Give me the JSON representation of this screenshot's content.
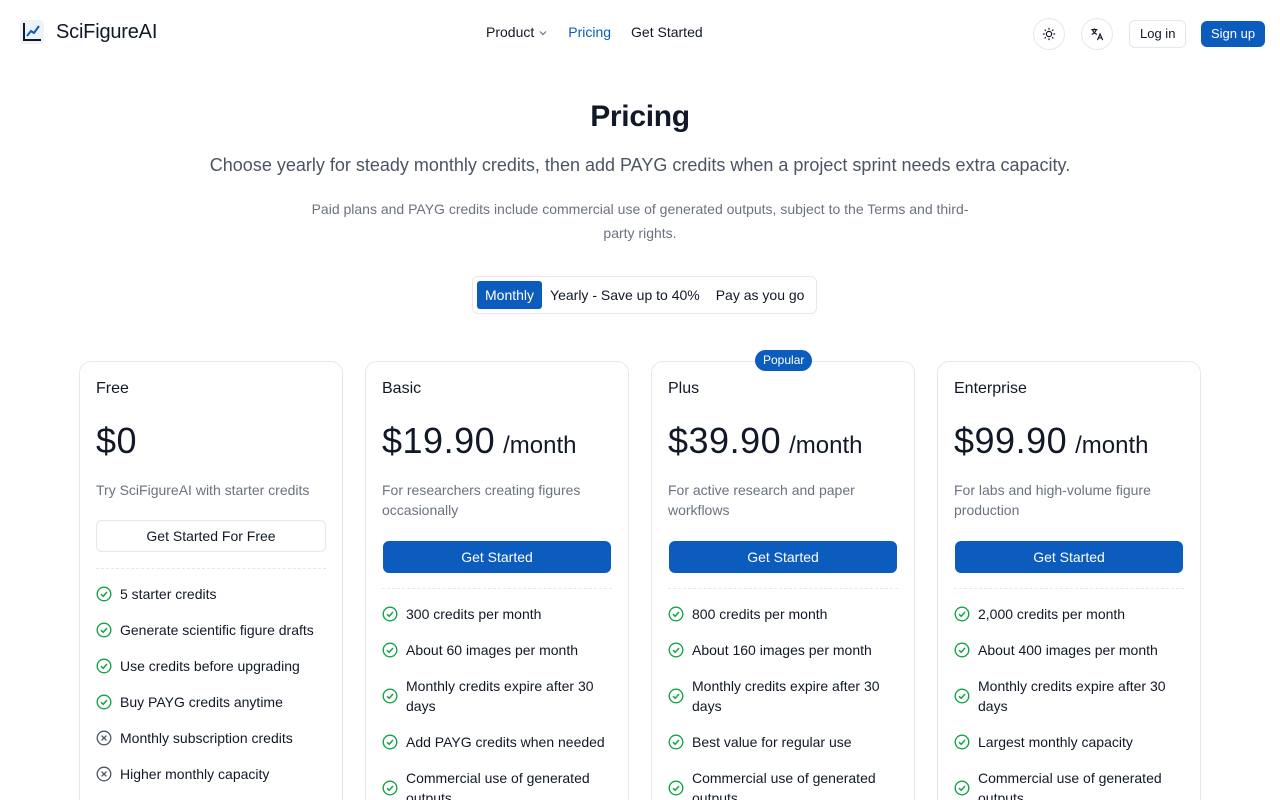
{
  "brand": {
    "name": "SciFigureAI",
    "accent": "#0b5cbd"
  },
  "nav": {
    "product": "Product",
    "pricing": "Pricing",
    "get_started": "Get Started",
    "theme_icon": "sun-icon",
    "language_icon": "translate-icon",
    "login": "Log in",
    "signup": "Sign up"
  },
  "hero": {
    "title": "Pricing",
    "subtitle": "Choose yearly for steady monthly credits, then add PAYG credits when a project sprint needs extra capacity.",
    "note": "Paid plans and PAYG credits include commercial use of generated outputs, subject to the Terms and third-party rights."
  },
  "billing_toggle": {
    "options": [
      "Monthly",
      "Yearly - Save up to 40%",
      "Pay as you go"
    ],
    "selected": "Monthly"
  },
  "plans": [
    {
      "name": "Free",
      "price": "$0",
      "period": "",
      "description": "Try SciFigureAI with starter credits",
      "cta": "Get Started For Free",
      "features": [
        {
          "text": "5 starter credits",
          "included": true
        },
        {
          "text": "Generate scientific figure drafts",
          "included": true
        },
        {
          "text": "Use credits before upgrading",
          "included": true
        },
        {
          "text": "Buy PAYG credits anytime",
          "included": true
        },
        {
          "text": "Monthly subscription credits",
          "included": false
        },
        {
          "text": "Higher monthly capacity",
          "included": false
        }
      ]
    },
    {
      "name": "Basic",
      "price": "$19.90",
      "period": "/month",
      "description": "For researchers creating figures occasionally",
      "cta": "Get Started",
      "features": [
        {
          "text": "300 credits per month",
          "included": true
        },
        {
          "text": "About 60 images per month",
          "included": true
        },
        {
          "text": "Monthly credits expire after 30 days",
          "included": true
        },
        {
          "text": "Add PAYG credits when needed",
          "included": true
        },
        {
          "text": "Commercial use of generated outputs",
          "included": true
        }
      ]
    },
    {
      "name": "Plus",
      "badge": "Popular",
      "price": "$39.90",
      "period": "/month",
      "description": "For active research and paper workflows",
      "cta": "Get Started",
      "features": [
        {
          "text": "800 credits per month",
          "included": true
        },
        {
          "text": "About 160 images per month",
          "included": true
        },
        {
          "text": "Monthly credits expire after 30 days",
          "included": true
        },
        {
          "text": "Best value for regular use",
          "included": true
        },
        {
          "text": "Commercial use of generated outputs",
          "included": true
        }
      ]
    },
    {
      "name": "Enterprise",
      "price": "$99.90",
      "period": "/month",
      "description": "For labs and high-volume figure production",
      "cta": "Get Started",
      "features": [
        {
          "text": "2,000 credits per month",
          "included": true
        },
        {
          "text": "About 400 images per month",
          "included": true
        },
        {
          "text": "Monthly credits expire after 30 days",
          "included": true
        },
        {
          "text": "Largest monthly capacity",
          "included": true
        },
        {
          "text": "Commercial use of generated outputs",
          "included": true
        }
      ]
    }
  ]
}
